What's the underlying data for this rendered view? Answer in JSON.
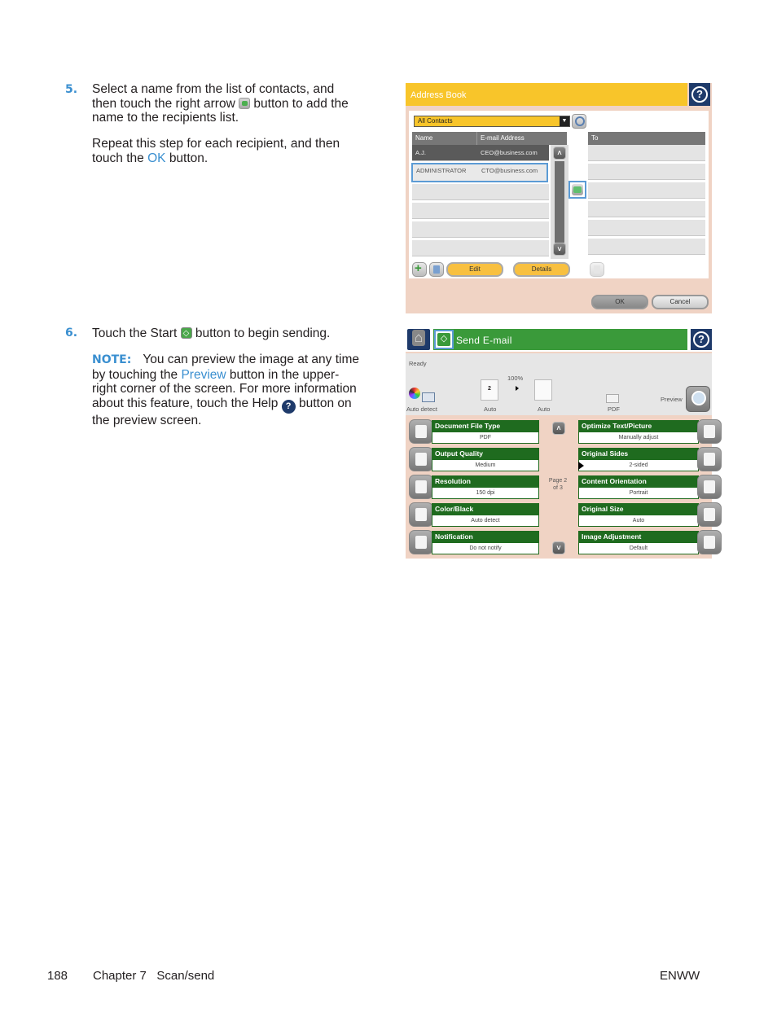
{
  "steps": [
    {
      "number": "5.",
      "text_1": "Select a name from the list of contacts, and then touch the right arrow",
      "text_2": "button to add the name to the recipients list.",
      "text_3": "Repeat this step for each recipient, and then touch the",
      "link": "OK",
      "text_4": "button."
    },
    {
      "number": "6.",
      "text_1": "Touch the Start",
      "text_2": "button to begin sending.",
      "note_label": "NOTE:",
      "note_1": "You can preview the image at any time by touching the",
      "note_link": "Preview",
      "note_2": "button in the upper-right corner of the screen. For more information about this feature, touch the Help",
      "note_3": "button on the preview screen."
    }
  ],
  "address_book": {
    "title": "Address Book",
    "help_icon": "question-mark-icon",
    "filter": "All Contacts",
    "columns": [
      "Name",
      "E-mail Address",
      "To"
    ],
    "contacts": [
      {
        "name": "A.J.",
        "email": "CEO@business.com"
      },
      {
        "name": "ADMINISTRATOR",
        "email": "CTO@business.com"
      }
    ],
    "buttons": {
      "edit": "Edit",
      "details": "Details",
      "ok": "OK",
      "cancel": "Cancel"
    }
  },
  "send_email": {
    "title": "Send E-mail",
    "status": "Ready",
    "preview_strip": {
      "color_label": "Auto detect",
      "copies_value": "2",
      "copies_label": "Auto",
      "zoom": "100%",
      "output_label": "Auto",
      "format_label": "PDF",
      "preview_label": "Preview"
    },
    "left_options": [
      {
        "title": "Document File Type",
        "value": "PDF",
        "icon": "document-icon"
      },
      {
        "title": "Output Quality",
        "value": "Medium",
        "icon": "quality-icon"
      },
      {
        "title": "Resolution",
        "value": "150 dpi",
        "icon": "resolution-icon"
      },
      {
        "title": "Color/Black",
        "value": "Auto detect",
        "icon": "color-icon"
      },
      {
        "title": "Notification",
        "value": "Do not notify",
        "icon": "notification-icon"
      }
    ],
    "right_options": [
      {
        "title": "Optimize Text/Picture",
        "value": "Manually adjust",
        "icon": "text-picture-icon"
      },
      {
        "title": "Original Sides",
        "value": "2-sided",
        "icon": "sides-icon"
      },
      {
        "title": "Content Orientation",
        "value": "Portrait",
        "icon": "orientation-icon"
      },
      {
        "title": "Original Size",
        "value": "Auto",
        "icon": "size-icon"
      },
      {
        "title": "Image Adjustment",
        "value": "Default",
        "icon": "image-adjust-icon"
      }
    ],
    "pager": {
      "line1": "Page 2",
      "line2": "of 3"
    }
  },
  "footer": {
    "page_number": "188",
    "chapter": "Chapter 7   Scan/send",
    "code": "ENWW"
  }
}
